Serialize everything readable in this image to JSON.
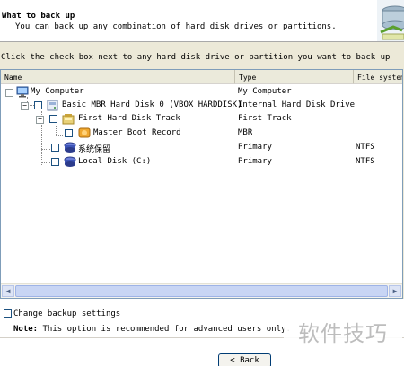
{
  "header": {
    "title": "What to back up",
    "subtitle": "You can back up any combination of hard disk drives or partitions."
  },
  "instruction": "Click the check box next to any hard disk drive or partition you want to back up",
  "columns": {
    "name": "Name",
    "type": "Type",
    "file_system": "File system"
  },
  "tree": [
    {
      "name": "My Computer",
      "type": "My Computer",
      "fs": "",
      "icon": "computer-icon"
    },
    {
      "name": "Basic MBR Hard Disk 0 (VBOX HARDDISK)",
      "type": "Internal Hard Disk Drive",
      "fs": "",
      "icon": "hard-disk-icon"
    },
    {
      "name": "First Hard Disk Track",
      "type": "First Track",
      "fs": "",
      "icon": "disk-track-icon"
    },
    {
      "name": "Master Boot Record",
      "type": "MBR",
      "fs": "",
      "icon": "mbr-icon"
    },
    {
      "name": "系统保留",
      "type": "Primary",
      "fs": "NTFS",
      "icon": "partition-icon"
    },
    {
      "name": "Local Disk (C:)",
      "type": "Primary",
      "fs": "NTFS",
      "icon": "partition-icon"
    }
  ],
  "options": {
    "change_backup_settings": "Change backup settings",
    "note_label": "Note:",
    "note_text": "This option is recommended for advanced users only."
  },
  "buttons": {
    "back": "< Back"
  },
  "watermark": "软件技巧"
}
